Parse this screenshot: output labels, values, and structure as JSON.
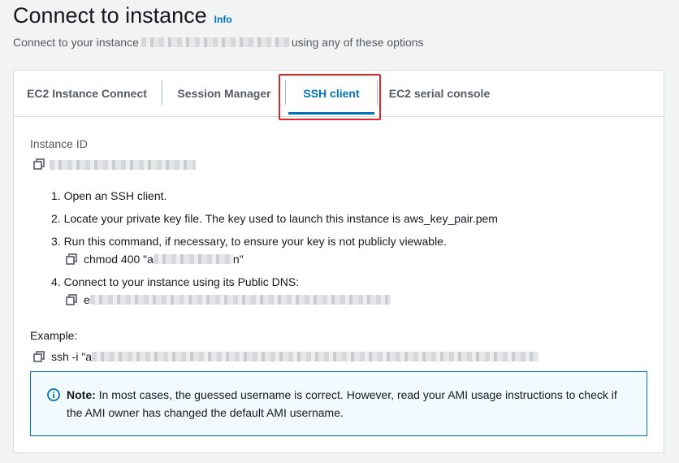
{
  "header": {
    "title": "Connect to instance",
    "info_link": "Info",
    "subtitle_prefix": "Connect to your instance",
    "subtitle_suffix": "using any of these options"
  },
  "tabs": [
    {
      "label": "EC2 Instance Connect",
      "active": false
    },
    {
      "label": "Session Manager",
      "active": false
    },
    {
      "label": "SSH client",
      "active": true
    },
    {
      "label": "EC2 serial console",
      "active": false
    }
  ],
  "content": {
    "instance_id_label": "Instance ID",
    "steps": [
      "1. Open an SSH client.",
      "2. Locate your private key file. The key used to launch this instance is aws_key_pair.pem",
      "3. Run this command, if necessary, to ensure your key is not publicly viewable.",
      "4. Connect to your instance using its Public DNS:"
    ],
    "chmod_prefix": "chmod 400 \"a",
    "chmod_suffix": "n\"",
    "dns_prefix": "e",
    "example_label": "Example:",
    "example_prefix": "ssh -i \"a"
  },
  "alert": {
    "title": "Note:",
    "body": "In most cases, the guessed username is correct. However, read your AMI usage instructions to check if the AMI owner has changed the default AMI username."
  },
  "colors": {
    "accent": "#0073bb",
    "highlight_box": "#e1262b",
    "alert_bg": "#f1faff"
  }
}
